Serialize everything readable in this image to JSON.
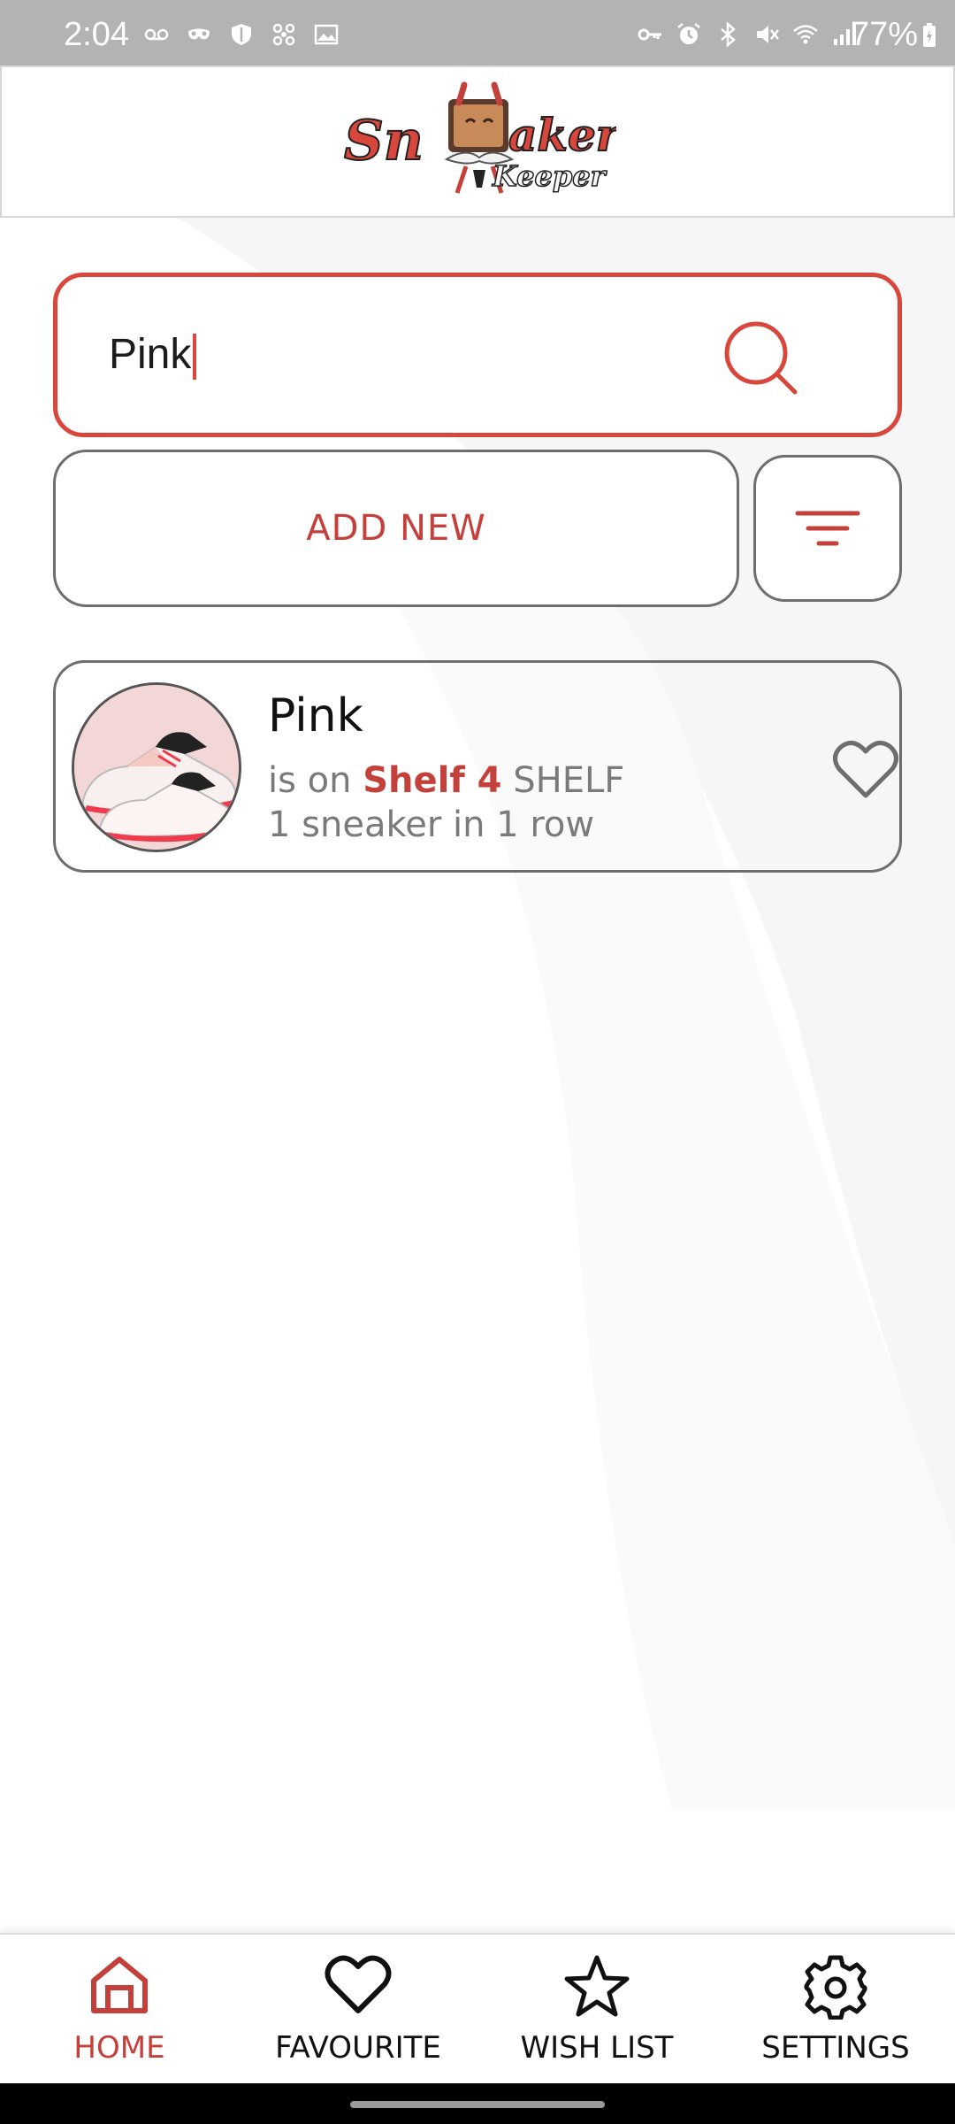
{
  "status_bar": {
    "time": "2:04",
    "battery": "77%"
  },
  "header": {
    "logo_text_main": "Sneaker",
    "logo_text_sub": "Keeper"
  },
  "search": {
    "value": "Pink",
    "placeholder": "Search"
  },
  "actions": {
    "add_label": "ADD NEW"
  },
  "result": {
    "title": "Pink",
    "prefix": "is on",
    "shelf": "Shelf 4",
    "suffix": "SHELF",
    "count_line": "1 sneaker in 1 row"
  },
  "nav": {
    "items": [
      {
        "label": "HOME",
        "icon": "home-icon",
        "active": true
      },
      {
        "label": "FAVOURITE",
        "icon": "heart-icon",
        "active": false
      },
      {
        "label": "WISH LIST",
        "icon": "star-icon",
        "active": false
      },
      {
        "label": "SETTINGS",
        "icon": "gear-icon",
        "active": false
      }
    ]
  },
  "colors": {
    "accent": "#d9463c",
    "accent_text": "#c4403a",
    "status_bar": "#b3b3b3"
  }
}
